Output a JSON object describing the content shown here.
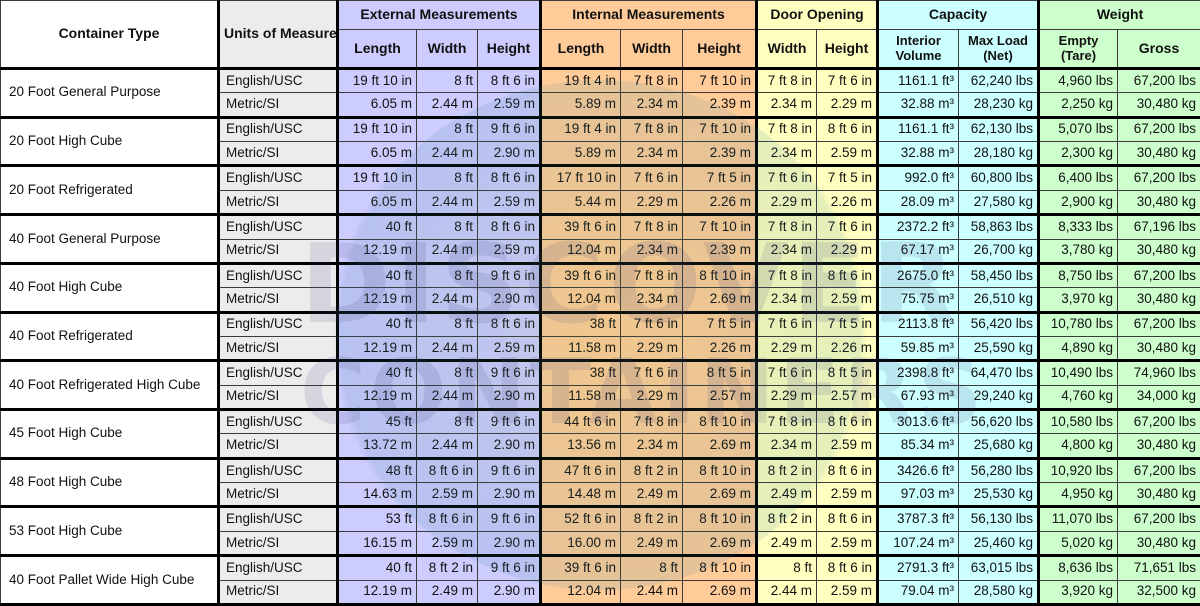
{
  "headers": {
    "container_type": "Container Type",
    "units": "Units of Measurement",
    "groups": {
      "external": "External Measurements",
      "internal": "Internal Measurements",
      "door": "Door Opening",
      "capacity": "Capacity",
      "weight": "Weight"
    },
    "sub": {
      "ext_length": "Length",
      "ext_width": "Width",
      "ext_height": "Height",
      "int_length": "Length",
      "int_width": "Width",
      "int_height": "Height",
      "door_width": "Width",
      "door_height": "Height",
      "interior_volume": "Interior Volume",
      "max_load": "Max Load (Net)",
      "empty": "Empty (Tare)",
      "gross": "Gross"
    }
  },
  "unit_labels": {
    "english": "English/USC",
    "metric": "Metric/SI"
  },
  "watermark": {
    "line1": "DISCOVER",
    "line2": "CONTAINERS"
  },
  "colors": {
    "external": "#ccccff",
    "internal": "#ffcc99",
    "door": "#ffffc0",
    "capacity": "#ccffff",
    "weight": "#ccffcc",
    "units": "#ececec"
  },
  "containers": [
    {
      "name": "20 Foot General Purpose",
      "english": [
        "19 ft 10 in",
        "8 ft",
        "8 ft 6 in",
        "19 ft 4 in",
        "7 ft 8 in",
        "7 ft 10 in",
        "7 ft 8 in",
        "7 ft 6 in",
        "1161.1 ft³",
        "62,240 lbs",
        "4,960 lbs",
        "67,200 lbs"
      ],
      "metric": [
        "6.05 m",
        "2.44 m",
        "2.59 m",
        "5.89 m",
        "2.34 m",
        "2.39 m",
        "2.34 m",
        "2.29 m",
        "32.88 m³",
        "28,230 kg",
        "2,250 kg",
        "30,480 kg"
      ]
    },
    {
      "name": "20 Foot High Cube",
      "english": [
        "19 ft 10 in",
        "8 ft",
        "9 ft 6 in",
        "19 ft 4 in",
        "7 ft 8 in",
        "7 ft 10 in",
        "7 ft 8 in",
        "8 ft 6 in",
        "1161.1 ft³",
        "62,130 lbs",
        "5,070 lbs",
        "67,200 lbs"
      ],
      "metric": [
        "6.05 m",
        "2.44 m",
        "2.90 m",
        "5.89 m",
        "2.34 m",
        "2.39 m",
        "2.34 m",
        "2.59 m",
        "32.88 m³",
        "28,180 kg",
        "2,300 kg",
        "30,480 kg"
      ]
    },
    {
      "name": "20 Foot Refrigerated",
      "english": [
        "19 ft 10 in",
        "8 ft",
        "8 ft 6 in",
        "17 ft 10 in",
        "7 ft 6 in",
        "7 ft 5 in",
        "7 ft 6 in",
        "7 ft 5 in",
        "992.0 ft³",
        "60,800 lbs",
        "6,400 lbs",
        "67,200 lbs"
      ],
      "metric": [
        "6.05 m",
        "2.44 m",
        "2.59 m",
        "5.44 m",
        "2.29 m",
        "2.26 m",
        "2.29 m",
        "2.26 m",
        "28.09 m³",
        "27,580 kg",
        "2,900 kg",
        "30,480 kg"
      ]
    },
    {
      "name": "40 Foot General Purpose",
      "english": [
        "40 ft",
        "8 ft",
        "8 ft 6 in",
        "39 ft 6 in",
        "7 ft 8 in",
        "7 ft 10 in",
        "7 ft 8 in",
        "7 ft 6 in",
        "2372.2 ft³",
        "58,863 lbs",
        "8,333 lbs",
        "67,196 lbs"
      ],
      "metric": [
        "12.19 m",
        "2.44 m",
        "2.59 m",
        "12.04 m",
        "2.34 m",
        "2.39 m",
        "2.34 m",
        "2.29 m",
        "67.17 m³",
        "26,700 kg",
        "3,780 kg",
        "30,480 kg"
      ]
    },
    {
      "name": "40 Foot High Cube",
      "english": [
        "40 ft",
        "8 ft",
        "9 ft 6 in",
        "39 ft 6 in",
        "7 ft 8 in",
        "8 ft 10 in",
        "7 ft 8 in",
        "8 ft 6 in",
        "2675.0 ft³",
        "58,450 lbs",
        "8,750 lbs",
        "67,200 lbs"
      ],
      "metric": [
        "12.19 m",
        "2.44 m",
        "2.90 m",
        "12.04 m",
        "2.34 m",
        "2.69 m",
        "2.34 m",
        "2.59 m",
        "75.75 m³",
        "26,510 kg",
        "3,970 kg",
        "30,480 kg"
      ]
    },
    {
      "name": "40 Foot Refrigerated",
      "english": [
        "40 ft",
        "8 ft",
        "8 ft 6 in",
        "38 ft",
        "7 ft 6 in",
        "7 ft 5 in",
        "7 ft 6 in",
        "7 ft 5 in",
        "2113.8 ft³",
        "56,420 lbs",
        "10,780 lbs",
        "67,200 lbs"
      ],
      "metric": [
        "12.19 m",
        "2.44 m",
        "2.59 m",
        "11.58 m",
        "2.29 m",
        "2.26 m",
        "2.29 m",
        "2.26 m",
        "59.85 m³",
        "25,590 kg",
        "4,890 kg",
        "30,480 kg"
      ]
    },
    {
      "name": "40 Foot Refrigerated High Cube",
      "english": [
        "40 ft",
        "8 ft",
        "9 ft 6 in",
        "38 ft",
        "7 ft 6 in",
        "8 ft 5 in",
        "7 ft 6 in",
        "8 ft 5 in",
        "2398.8 ft³",
        "64,470 lbs",
        "10,490 lbs",
        "74,960 lbs"
      ],
      "metric": [
        "12.19 m",
        "2.44 m",
        "2.90 m",
        "11.58 m",
        "2.29 m",
        "2.57 m",
        "2.29 m",
        "2.57 m",
        "67.93 m³",
        "29,240 kg",
        "4,760 kg",
        "34,000 kg"
      ]
    },
    {
      "name": "45 Foot High Cube",
      "english": [
        "45 ft",
        "8 ft",
        "9 ft 6 in",
        "44 ft 6 in",
        "7 ft 8 in",
        "8 ft 10 in",
        "7 ft 8 in",
        "8 ft 6 in",
        "3013.6 ft³",
        "56,620 lbs",
        "10,580 lbs",
        "67,200 lbs"
      ],
      "metric": [
        "13.72 m",
        "2.44 m",
        "2.90 m",
        "13.56 m",
        "2.34 m",
        "2.69 m",
        "2.34 m",
        "2.59 m",
        "85.34 m³",
        "25,680 kg",
        "4,800 kg",
        "30,480 kg"
      ]
    },
    {
      "name": "48 Foot High Cube",
      "english": [
        "48 ft",
        "8 ft 6 in",
        "9 ft 6 in",
        "47 ft 6 in",
        "8 ft 2 in",
        "8 ft 10 in",
        "8 ft 2 in",
        "8 ft 6 in",
        "3426.6 ft³",
        "56,280 lbs",
        "10,920 lbs",
        "67,200 lbs"
      ],
      "metric": [
        "14.63 m",
        "2.59 m",
        "2.90 m",
        "14.48 m",
        "2.49 m",
        "2.69 m",
        "2.49 m",
        "2.59 m",
        "97.03 m³",
        "25,530 kg",
        "4,950 kg",
        "30,480 kg"
      ]
    },
    {
      "name": "53 Foot High Cube",
      "english": [
        "53 ft",
        "8 ft 6 in",
        "9 ft 6 in",
        "52 ft 6 in",
        "8 ft 2 in",
        "8 ft 10 in",
        "8 ft 2 in",
        "8 ft 6 in",
        "3787.3 ft³",
        "56,130 lbs",
        "11,070 lbs",
        "67,200 lbs"
      ],
      "metric": [
        "16.15 m",
        "2.59 m",
        "2.90 m",
        "16.00 m",
        "2.49 m",
        "2.69 m",
        "2.49 m",
        "2.59 m",
        "107.24 m³",
        "25,460 kg",
        "5,020 kg",
        "30,480 kg"
      ]
    },
    {
      "name": "40 Foot Pallet Wide High Cube",
      "english": [
        "40 ft",
        "8 ft 2 in",
        "9 ft 6 in",
        "39 ft 6 in",
        "8 ft",
        "8 ft 10 in",
        "8 ft",
        "8 ft 6 in",
        "2791.3 ft³",
        "63,015 lbs",
        "8,636 lbs",
        "71,651 lbs"
      ],
      "metric": [
        "12.19 m",
        "2.49 m",
        "2.90 m",
        "12.04 m",
        "2.44 m",
        "2.69 m",
        "2.44 m",
        "2.59 m",
        "79.04 m³",
        "28,580 kg",
        "3,920 kg",
        "32,500 kg"
      ]
    }
  ]
}
